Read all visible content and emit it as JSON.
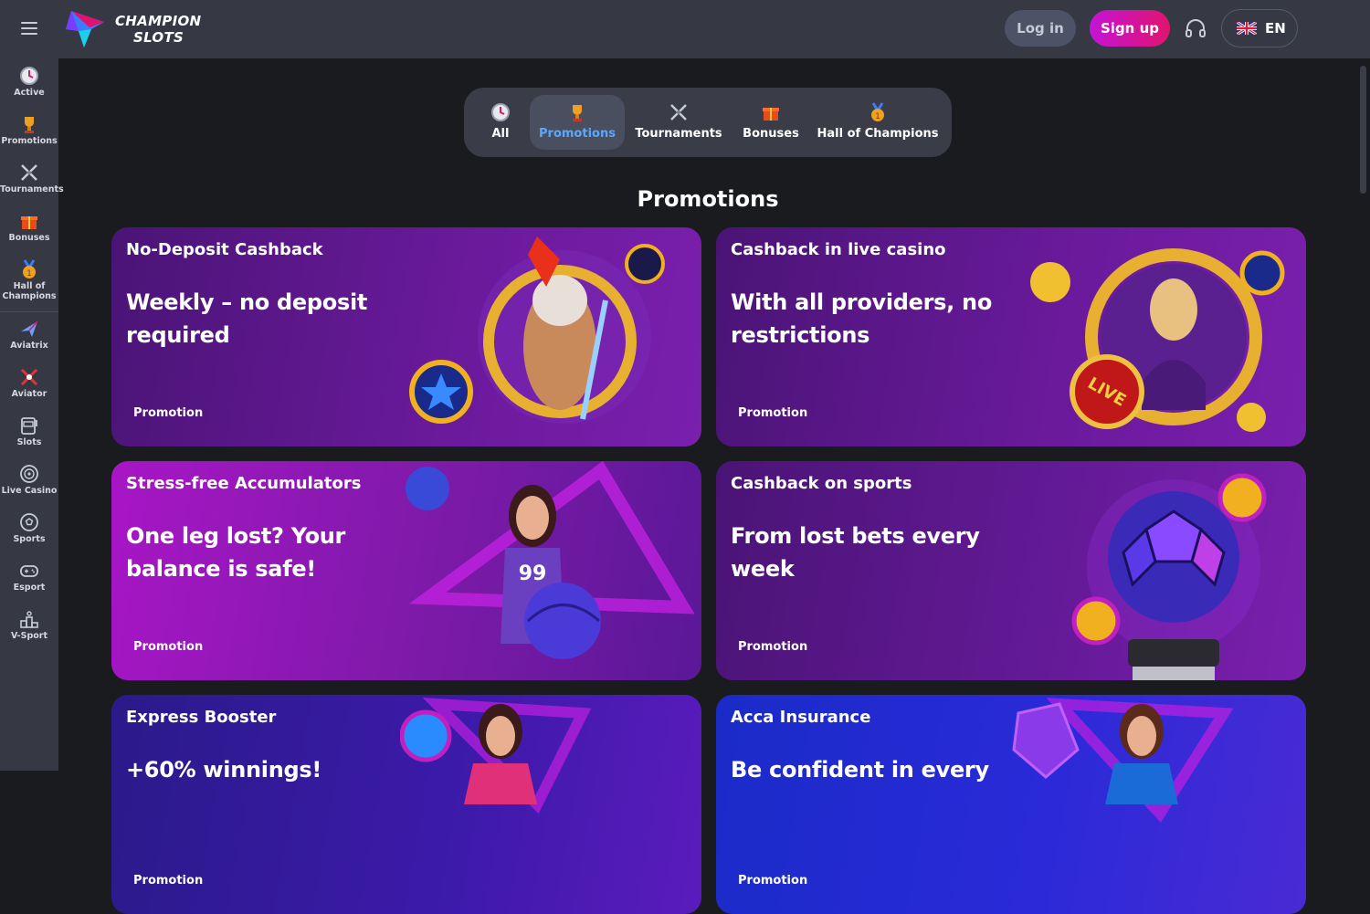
{
  "header": {
    "logo_line1": "CHAMPION",
    "logo_line2": "SLOTS",
    "login_label": "Log in",
    "signup_label": "Sign up",
    "language": "EN"
  },
  "sidebar": {
    "items": [
      {
        "label": "Active",
        "icon": "clock-icon"
      },
      {
        "label": "Promotions",
        "icon": "trophy-icon"
      },
      {
        "label": "Tournaments",
        "icon": "crossed-swords-icon"
      },
      {
        "label": "Bonuses",
        "icon": "gift-icon"
      },
      {
        "label": "Hall of Champions",
        "icon": "medal-icon"
      },
      {
        "label": "Aviatrix",
        "icon": "plane-icon"
      },
      {
        "label": "Aviator",
        "icon": "aviator-icon"
      },
      {
        "label": "Slots",
        "icon": "slot-machine-icon"
      },
      {
        "label": "Live Casino",
        "icon": "chip-icon"
      },
      {
        "label": "Sports",
        "icon": "soccer-ball-icon"
      },
      {
        "label": "Esport",
        "icon": "gamepad-icon"
      },
      {
        "label": "V-Sport",
        "icon": "podium-icon"
      }
    ]
  },
  "tabs": [
    {
      "label": "All",
      "icon": "clock-icon",
      "active": false
    },
    {
      "label": "Promotions",
      "icon": "trophy-icon",
      "active": true
    },
    {
      "label": "Tournaments",
      "icon": "crossed-swords-icon",
      "active": false
    },
    {
      "label": "Bonuses",
      "icon": "gift-icon",
      "active": false
    },
    {
      "label": "Hall of Champions",
      "icon": "medal-icon",
      "active": false
    }
  ],
  "section_title": "Promotions",
  "cards": [
    {
      "title": "No-Deposit Cashback",
      "subtitle": "Weekly – no deposit required",
      "tag": "Promotion"
    },
    {
      "title": "Cashback in live casino",
      "subtitle": "With all providers, no restrictions",
      "tag": "Promotion"
    },
    {
      "title": "Stress-free Accumulators",
      "subtitle": "One leg lost? Your balance is safe!",
      "tag": "Promotion"
    },
    {
      "title": "Cashback on sports",
      "subtitle": "From lost bets every week",
      "tag": "Promotion"
    },
    {
      "title": "Express Booster",
      "subtitle": "+60% winnings!",
      "tag": "Promotion"
    },
    {
      "title": "Acca Insurance",
      "subtitle": "Be confident in every",
      "tag": "Promotion"
    }
  ],
  "colors": {
    "accent_blue": "#5aa7ff",
    "signup_gradient_start": "#c414d6",
    "signup_gradient_end": "#e0146e",
    "topbar_bg": "#363944",
    "page_bg": "#1a1b1f"
  }
}
